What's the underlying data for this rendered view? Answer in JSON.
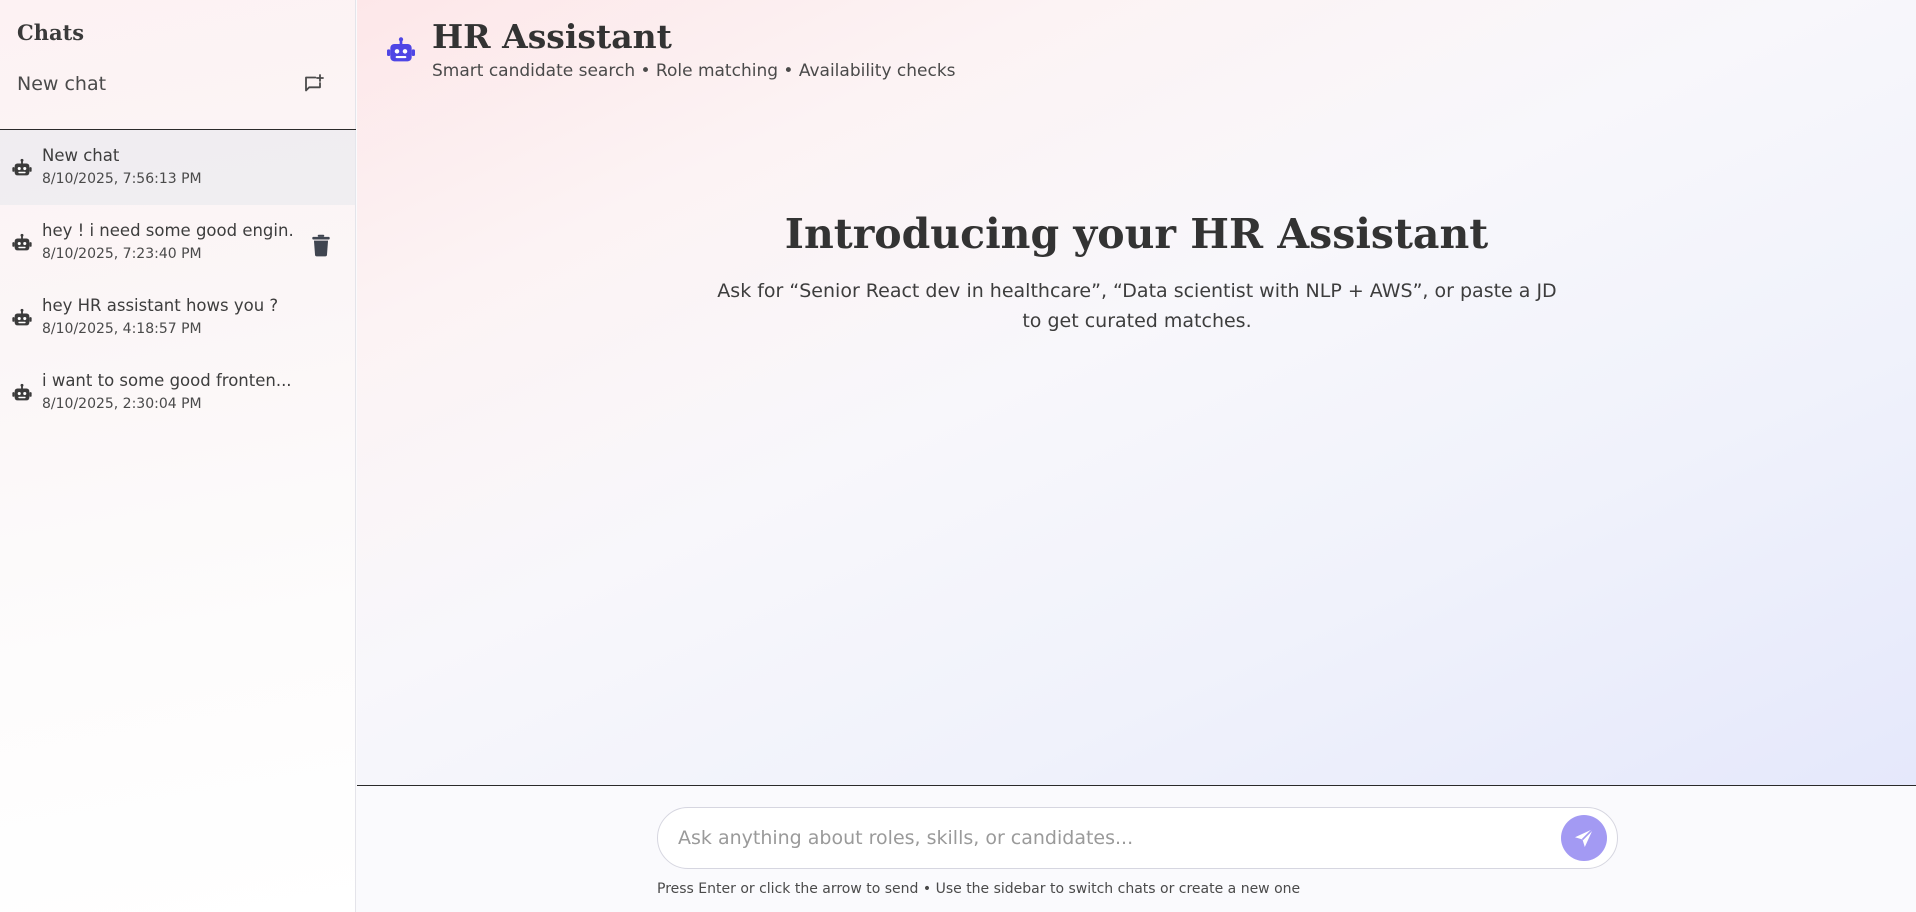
{
  "sidebar": {
    "title": "Chats",
    "new_chat_label": "New chat",
    "new_chat_icon": "add-comment-icon",
    "chats": [
      {
        "title": "New chat",
        "time": "8/10/2025, 7:56:13 PM",
        "active": true
      },
      {
        "title": "hey ! i need some good engin...",
        "time": "8/10/2025, 7:23:40 PM",
        "hovered": true
      },
      {
        "title": "hey HR assistant hows you ?",
        "time": "8/10/2025, 4:18:57 PM"
      },
      {
        "title": "i want to some good fronten...",
        "time": "8/10/2025, 2:30:04 PM"
      }
    ]
  },
  "header": {
    "title": "HR Assistant",
    "subtitle": "Smart candidate search • Role matching • Availability checks",
    "icon": "robot-icon",
    "icon_color": "#4f46e5"
  },
  "intro": {
    "title": "Introducing your HR Assistant",
    "text": "Ask for “Senior React dev in healthcare”, “Data scientist with NLP + AWS”, or paste a JD to get curated matches."
  },
  "composer": {
    "placeholder": "Ask anything about roles, skills, or candidates...",
    "value": "",
    "send_icon": "send-icon",
    "send_color": "#a39af3",
    "hint": "Press Enter or click the arrow to send • Use the sidebar to switch chats or create a new one"
  }
}
